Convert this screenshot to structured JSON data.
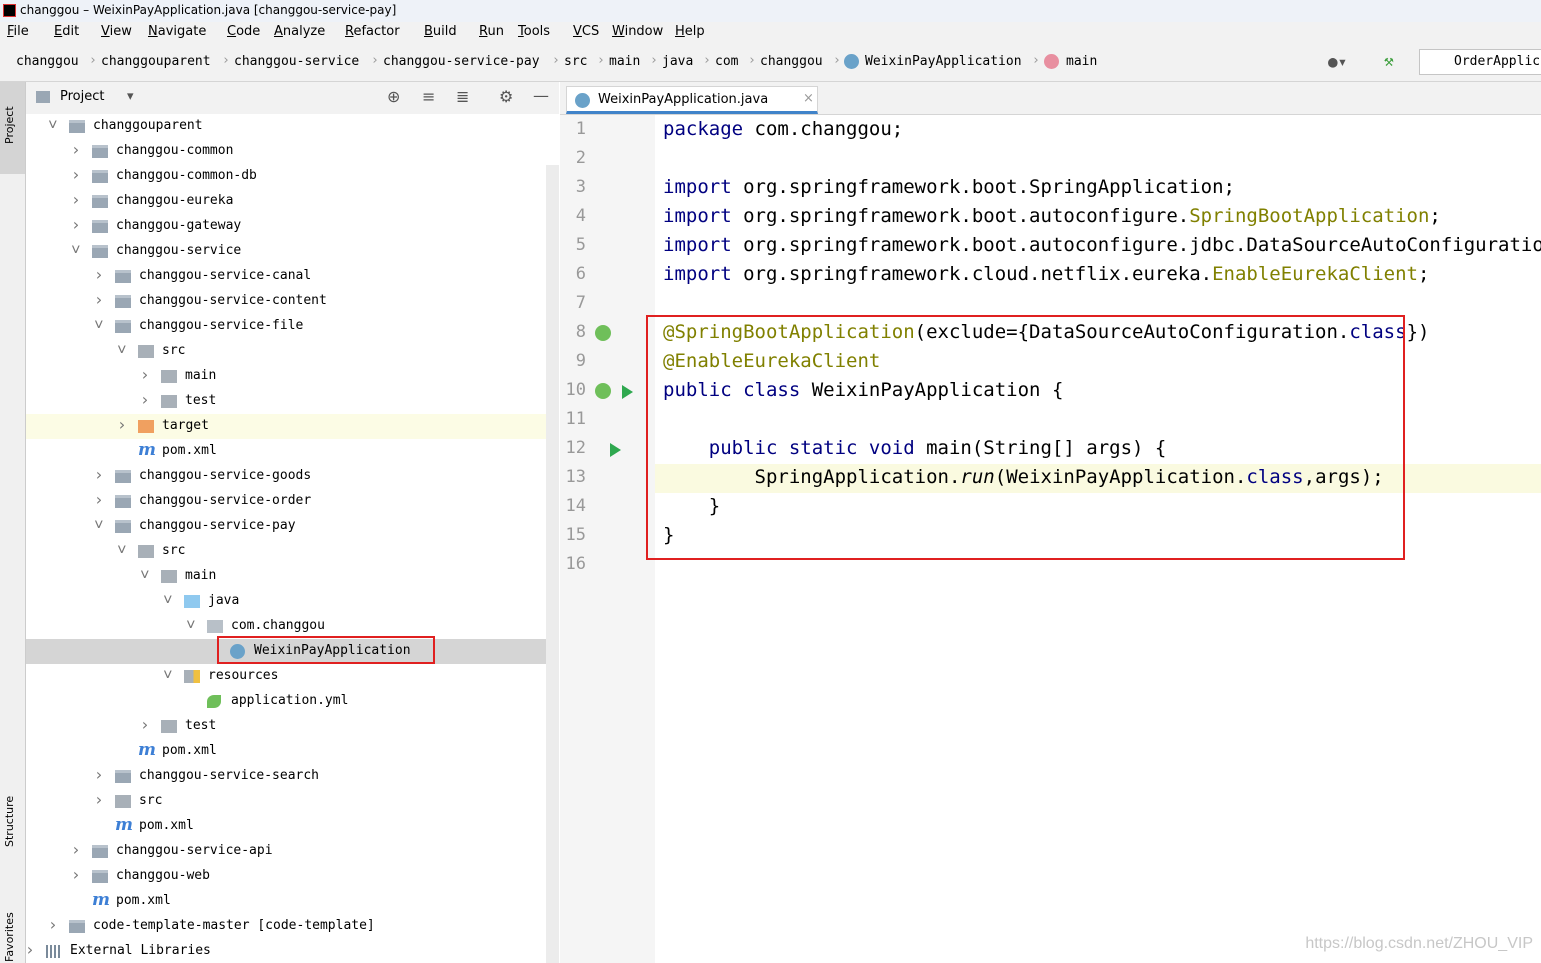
{
  "window": {
    "title": "changgou – WeixinPayApplication.java [changgou-service-pay]"
  },
  "menu": [
    "File",
    "Edit",
    "View",
    "Navigate",
    "Code",
    "Analyze",
    "Refactor",
    "Build",
    "Run",
    "Tools",
    "VCS",
    "Window",
    "Help"
  ],
  "breadcrumb": [
    "changgou",
    "changgouparent",
    "changgou-service",
    "changgou-service-pay",
    "src",
    "main",
    "java",
    "com",
    "changgou",
    "WeixinPayApplication",
    "main"
  ],
  "run_config": "OrderApplic",
  "side_tabs": {
    "project": "Project",
    "structure": "Structure",
    "favorites": "Favorites"
  },
  "project_panel": {
    "title": "Project",
    "tree": [
      {
        "label": "changgouparent",
        "depth": 0,
        "type": "module",
        "arrow": "down"
      },
      {
        "label": "changgou-common",
        "depth": 1,
        "type": "module",
        "arrow": "right"
      },
      {
        "label": "changgou-common-db",
        "depth": 1,
        "type": "module",
        "arrow": "right"
      },
      {
        "label": "changgou-eureka",
        "depth": 1,
        "type": "module",
        "arrow": "right"
      },
      {
        "label": "changgou-gateway",
        "depth": 1,
        "type": "module",
        "arrow": "right"
      },
      {
        "label": "changgou-service",
        "depth": 1,
        "type": "module",
        "arrow": "down"
      },
      {
        "label": "changgou-service-canal",
        "depth": 2,
        "type": "module",
        "arrow": "right"
      },
      {
        "label": "changgou-service-content",
        "depth": 2,
        "type": "module",
        "arrow": "right"
      },
      {
        "label": "changgou-service-file",
        "depth": 2,
        "type": "module",
        "arrow": "down"
      },
      {
        "label": "src",
        "depth": 3,
        "type": "folder",
        "arrow": "down"
      },
      {
        "label": "main",
        "depth": 4,
        "type": "folder",
        "arrow": "right"
      },
      {
        "label": "test",
        "depth": 4,
        "type": "folder",
        "arrow": "right"
      },
      {
        "label": "target",
        "depth": 3,
        "type": "excluded",
        "arrow": "right",
        "highlight": "yellow"
      },
      {
        "label": "pom.xml",
        "depth": 3,
        "type": "maven",
        "arrow": ""
      },
      {
        "label": "changgou-service-goods",
        "depth": 2,
        "type": "module",
        "arrow": "right"
      },
      {
        "label": "changgou-service-order",
        "depth": 2,
        "type": "module",
        "arrow": "right"
      },
      {
        "label": "changgou-service-pay",
        "depth": 2,
        "type": "module",
        "arrow": "down"
      },
      {
        "label": "src",
        "depth": 3,
        "type": "folder",
        "arrow": "down"
      },
      {
        "label": "main",
        "depth": 4,
        "type": "folder",
        "arrow": "down"
      },
      {
        "label": "java",
        "depth": 5,
        "type": "source",
        "arrow": "down"
      },
      {
        "label": "com.changgou",
        "depth": 6,
        "type": "package",
        "arrow": "down"
      },
      {
        "label": "WeixinPayApplication",
        "depth": 7,
        "type": "class",
        "arrow": "",
        "selected": true
      },
      {
        "label": "resources",
        "depth": 5,
        "type": "resources",
        "arrow": "down"
      },
      {
        "label": "application.yml",
        "depth": 6,
        "type": "yml",
        "arrow": ""
      },
      {
        "label": "test",
        "depth": 4,
        "type": "folder",
        "arrow": "right"
      },
      {
        "label": "pom.xml",
        "depth": 3,
        "type": "maven",
        "arrow": ""
      },
      {
        "label": "changgou-service-search",
        "depth": 2,
        "type": "module",
        "arrow": "right"
      },
      {
        "label": "src",
        "depth": 2,
        "type": "folder",
        "arrow": "right"
      },
      {
        "label": "pom.xml",
        "depth": 2,
        "type": "maven",
        "arrow": ""
      },
      {
        "label": "changgou-service-api",
        "depth": 1,
        "type": "module",
        "arrow": "right"
      },
      {
        "label": "changgou-web",
        "depth": 1,
        "type": "module",
        "arrow": "right"
      },
      {
        "label": "pom.xml",
        "depth": 1,
        "type": "maven",
        "arrow": ""
      },
      {
        "label": "code-template-master",
        "suffix": "[code-template]",
        "depth": 0,
        "type": "module",
        "arrow": "right"
      },
      {
        "label": "External Libraries",
        "depth": -1,
        "type": "libs",
        "arrow": "right"
      }
    ]
  },
  "editor": {
    "tab": "WeixinPayApplication.java",
    "lines": [
      {
        "n": "1",
        "tokens": [
          [
            "kw",
            "package"
          ],
          [
            "",
            "com.changgou;"
          ]
        ]
      },
      {
        "n": "2",
        "tokens": []
      },
      {
        "n": "3",
        "tokens": [
          [
            "kw",
            "import"
          ],
          [
            "",
            " org.springframework.boot.SpringApplication;"
          ]
        ]
      },
      {
        "n": "4",
        "tokens": [
          [
            "kw",
            "import"
          ],
          [
            "",
            " org.springframework.boot.autoconfigure."
          ],
          [
            "cls",
            "SpringBootApplication"
          ],
          [
            "",
            ";"
          ]
        ]
      },
      {
        "n": "5",
        "tokens": [
          [
            "kw",
            "import"
          ],
          [
            "",
            " org.springframework.boot.autoconfigure.jdbc.DataSourceAutoConfiguration;"
          ]
        ]
      },
      {
        "n": "6",
        "tokens": [
          [
            "kw",
            "import"
          ],
          [
            "",
            " org.springframework.cloud.netflix.eureka."
          ],
          [
            "cls",
            "EnableEurekaClient"
          ],
          [
            "",
            ";"
          ]
        ]
      },
      {
        "n": "7",
        "tokens": []
      },
      {
        "n": "8",
        "tokens": [
          [
            "ann",
            "@SpringBootApplication"
          ],
          [
            "",
            "(exclude={DataSourceAutoConfiguration."
          ],
          [
            "kw",
            "class"
          ],
          [
            "",
            "})"
          ]
        ]
      },
      {
        "n": "9",
        "tokens": [
          [
            "ann",
            "@EnableEurekaClient"
          ]
        ]
      },
      {
        "n": "10",
        "tokens": [
          [
            "kw",
            "public class"
          ],
          [
            "",
            " WeixinPayApplication {"
          ]
        ]
      },
      {
        "n": "11",
        "tokens": []
      },
      {
        "n": "12",
        "tokens": [
          [
            "",
            "    "
          ],
          [
            "kw",
            "public static void"
          ],
          [
            "",
            " main(String[] args) {"
          ]
        ]
      },
      {
        "n": "13",
        "tokens": [
          [
            "",
            "        SpringApplication."
          ],
          [
            "it",
            "run"
          ],
          [
            "",
            "(WeixinPayApplication."
          ],
          [
            "kw",
            "class"
          ],
          [
            "",
            ",args);"
          ]
        ]
      },
      {
        "n": "14",
        "tokens": [
          [
            "",
            "    }"
          ]
        ]
      },
      {
        "n": "15",
        "tokens": [
          [
            "",
            "}"
          ]
        ]
      },
      {
        "n": "16",
        "tokens": []
      }
    ]
  },
  "watermark": "https://blog.csdn.net/ZHOU_VIP"
}
